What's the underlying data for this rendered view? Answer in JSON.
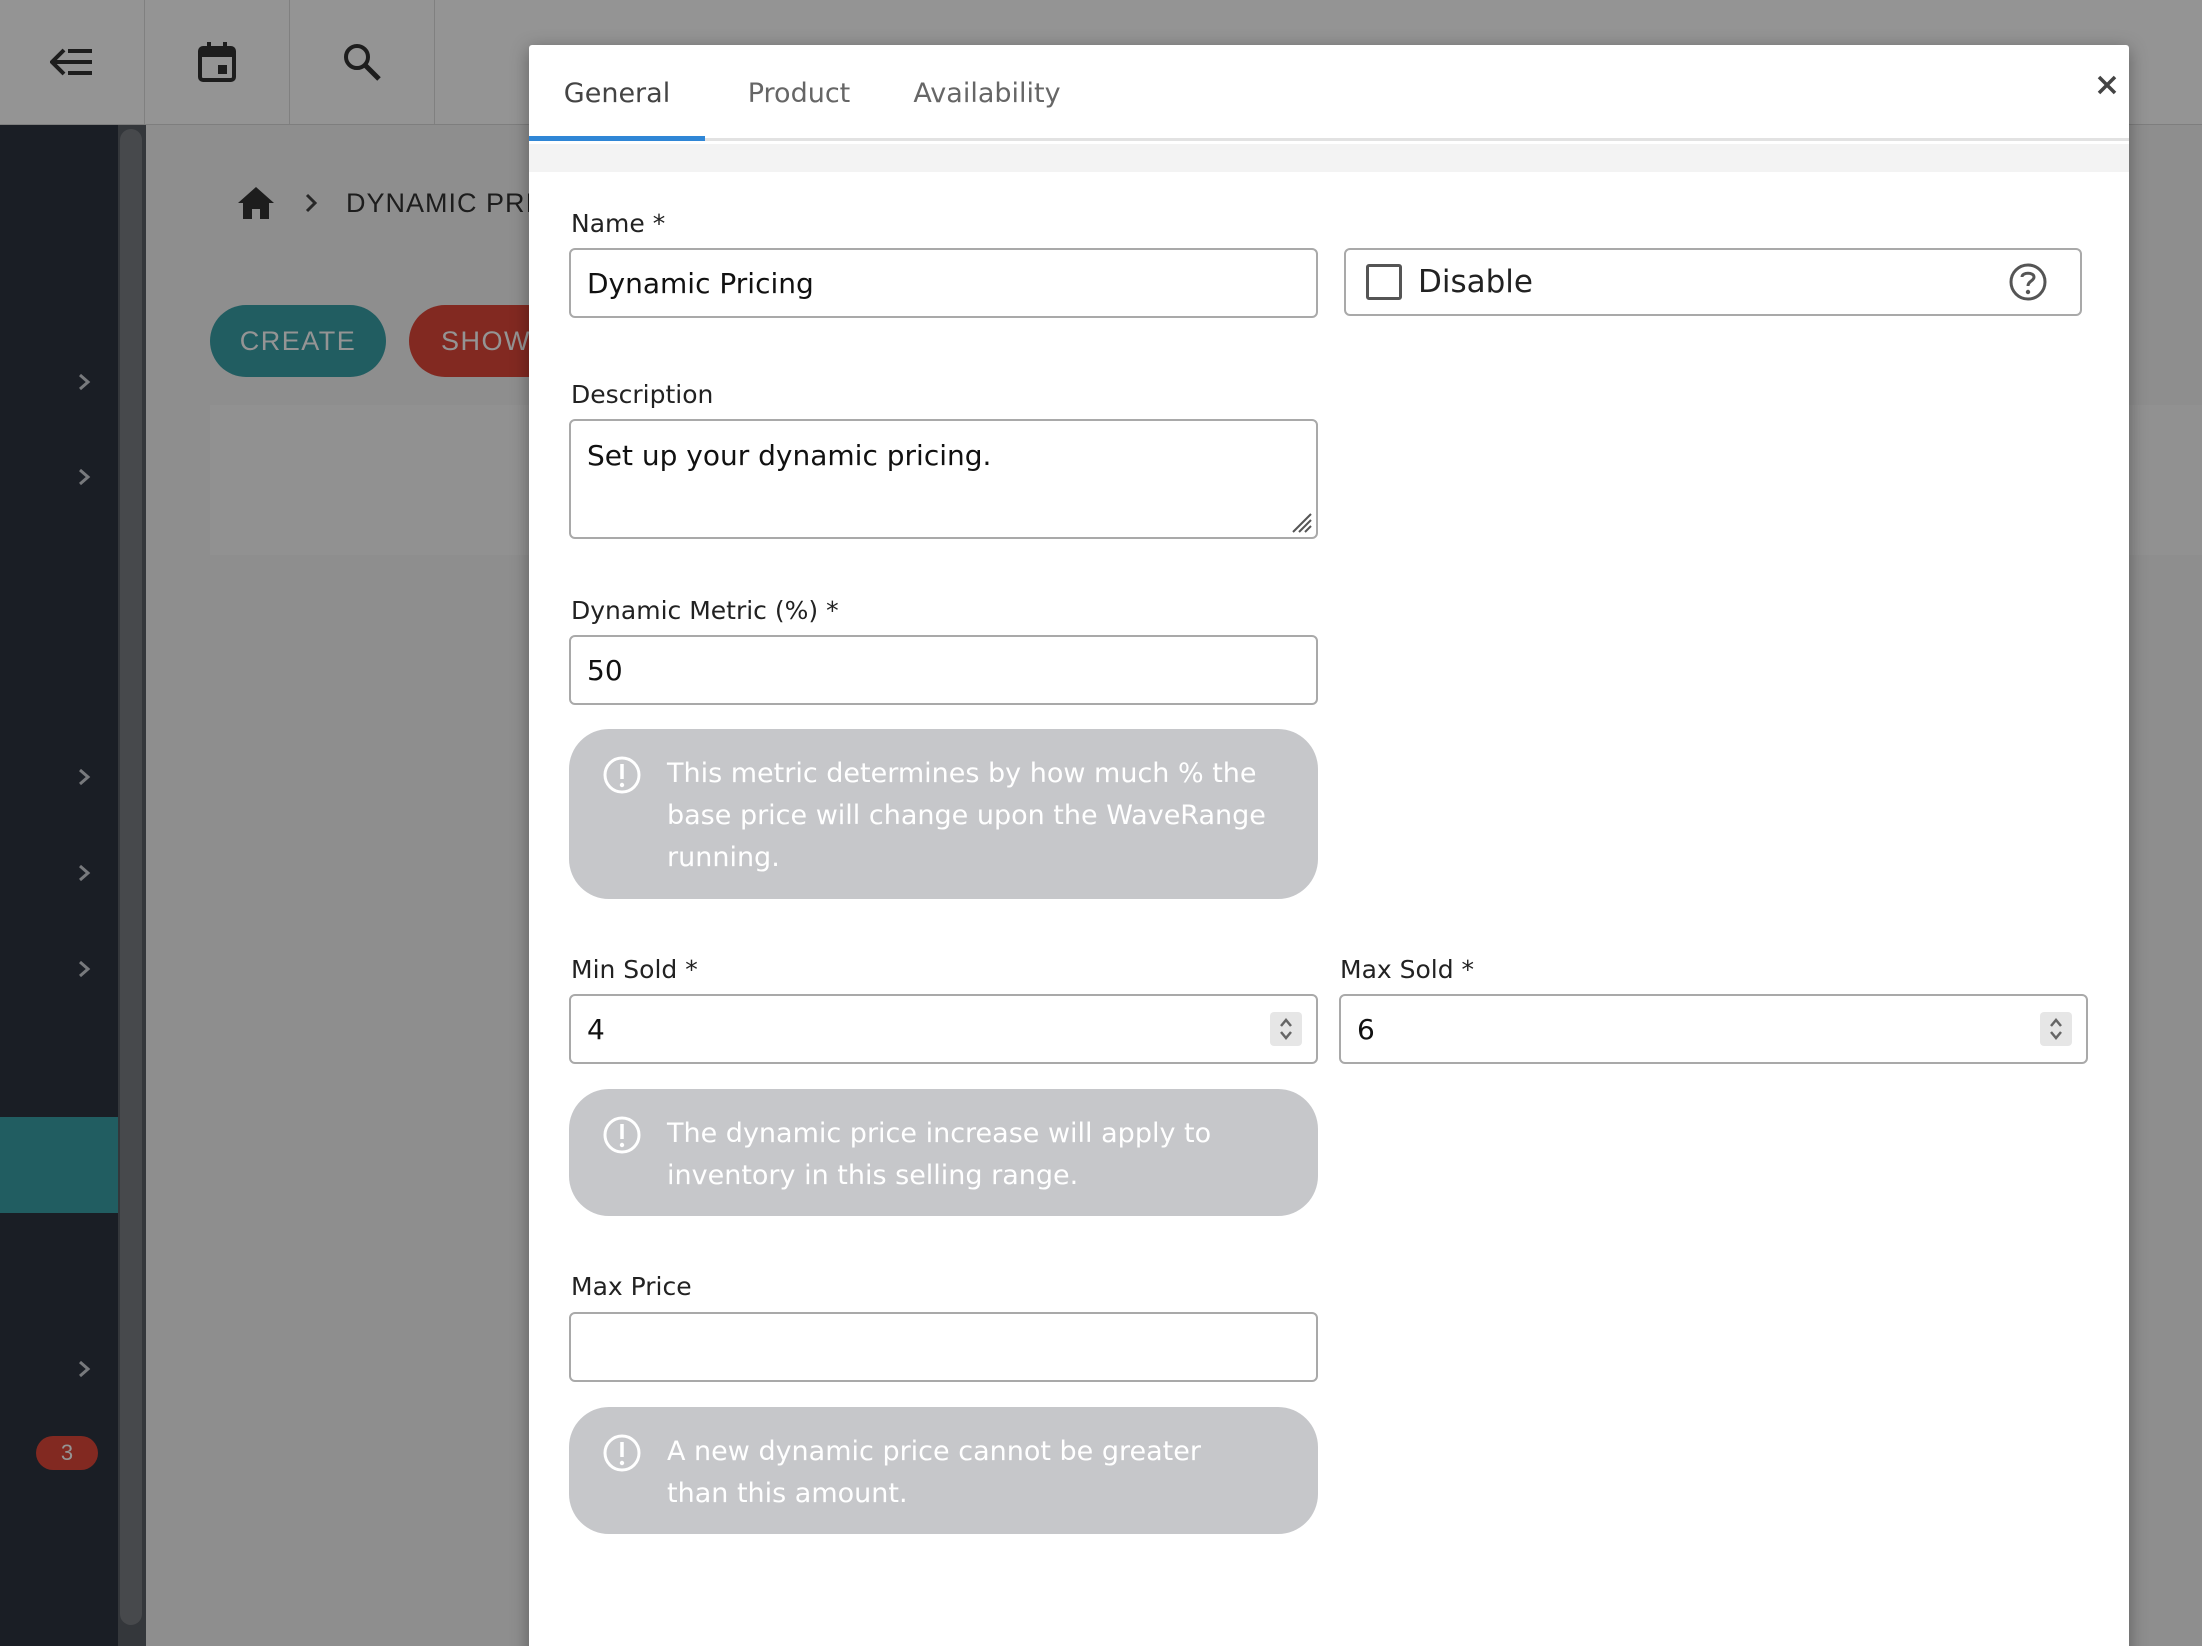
{
  "background": {
    "breadcrumb": "DYNAMIC PRI",
    "buttons": {
      "create": "CREATE",
      "show": "SHOW"
    },
    "sidebar_badge": "3",
    "colors": {
      "sidebar": "#2e3440",
      "accent": "#3aa0a8",
      "danger": "#e0483a"
    }
  },
  "modal": {
    "tabs": [
      {
        "label": "General"
      },
      {
        "label": "Product"
      },
      {
        "label": "Availability"
      }
    ],
    "close_icon": "close-icon",
    "fields": {
      "name": {
        "label": "Name *",
        "value": "Dynamic Pricing"
      },
      "disable": {
        "label": "Disable",
        "checked": false,
        "icon": "help-circle-icon"
      },
      "description": {
        "label": "Description",
        "value": "Set up your dynamic pricing."
      },
      "dynamic_metric": {
        "label": "Dynamic Metric (%) *",
        "value": "50"
      },
      "min_sold": {
        "label": "Min Sold *",
        "value": "4"
      },
      "max_sold": {
        "label": "Max Sold *",
        "value": "6"
      },
      "max_price": {
        "label": "Max Price",
        "value": ""
      }
    },
    "info": {
      "metric": "This metric determines by how much % the base price will change upon the WaveRange running.",
      "range": "The dynamic price increase will apply to inventory in this selling range.",
      "max_price": "A new dynamic price cannot be greater than this amount."
    },
    "accent_color": "#2f86d6"
  }
}
